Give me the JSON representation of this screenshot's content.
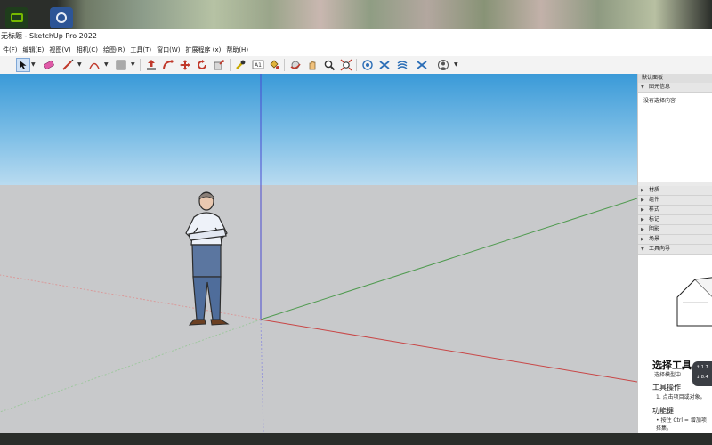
{
  "window": {
    "title": "无标题 - SketchUp Pro 2022"
  },
  "menu": [
    "件(F)",
    "编辑(E)",
    "视图(V)",
    "相机(C)",
    "绘图(R)",
    "工具(T)",
    "窗口(W)",
    "扩展程序 (x)",
    "帮助(H)"
  ],
  "toolbar": {
    "icons": [
      "select-tool",
      "eraser-tool",
      "line-tool",
      "arc-tool",
      "shape-tool",
      "push-pull-tool",
      "follow-me-tool",
      "move-tool",
      "rotate-tool",
      "scale-tool",
      "tape-measure-tool",
      "text-tool",
      "paint-bucket-tool",
      "orbit-tool",
      "pan-tool",
      "zoom-tool",
      "zoom-extents-tool",
      "3d-warehouse",
      "extension-warehouse",
      "layout",
      "sandbox",
      "account"
    ]
  },
  "panel": {
    "title": "默认面板",
    "entity_info": {
      "label": "图元信息",
      "body": "没有选择内容"
    },
    "trays": [
      "材质",
      "组件",
      "样式",
      "标记",
      "阴影",
      "场景",
      "工具向导"
    ],
    "instructor": {
      "title": "选择工具",
      "subtitle": "选择模型中",
      "operations_heading": "工具操作",
      "operations_text": "1. 点击项目或对象。",
      "keys_heading": "功能键",
      "keys_text_1": "• 按住 Ctrl = 增加项",
      "keys_text_2": "择集。"
    }
  },
  "net_widget": {
    "up": "1.7",
    "down": "8.4"
  },
  "colors": {
    "sky_top": "#3a9ad8",
    "ground": "#c8c9cb",
    "red_axis": "#c84646",
    "green_axis": "#4f9a4f",
    "blue_axis": "#4a4ad0"
  }
}
